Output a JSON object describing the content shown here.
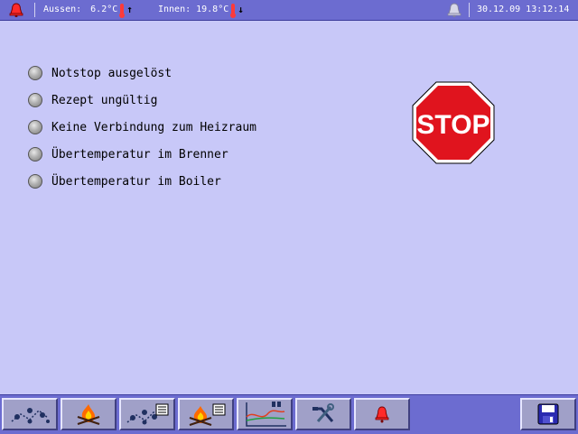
{
  "status_bar": {
    "outside_label": "Aussen:",
    "outside_temp": "6.2°C",
    "outside_trend": "↑",
    "inside_label": "Innen:",
    "inside_temp": "19.8°C",
    "inside_trend": "↓",
    "datetime": "30.12.09 13:12:14",
    "icons": {
      "alarm": "alarm-bell-icon",
      "notification": "bell-icon",
      "thermometer": "thermometer-icon"
    }
  },
  "alarms": [
    {
      "label": "Notstop ausgelöst"
    },
    {
      "label": "Rezept ungültig"
    },
    {
      "label": "Keine Verbindung zum Heizraum"
    },
    {
      "label": "Übertemperatur im Brenner"
    },
    {
      "label": "Übertemperatur im Boiler"
    }
  ],
  "stop_sign": {
    "text": "STOP",
    "color": "#e0141e"
  },
  "toolbar": {
    "buttons": [
      {
        "icon": "heating-circuit-icon"
      },
      {
        "icon": "burner-flame-icon"
      },
      {
        "icon": "heating-schedule-icon"
      },
      {
        "icon": "burner-schedule-icon"
      },
      {
        "icon": "trend-chart-icon"
      },
      {
        "icon": "service-tools-icon"
      },
      {
        "icon": "alarm-icon"
      },
      {
        "icon": "save-disk-icon"
      }
    ]
  },
  "colors": {
    "background": "#c8c8f8",
    "bar": "#6c6cd0",
    "button": "#a0a0c8",
    "alarm_red": "#e0141e"
  }
}
